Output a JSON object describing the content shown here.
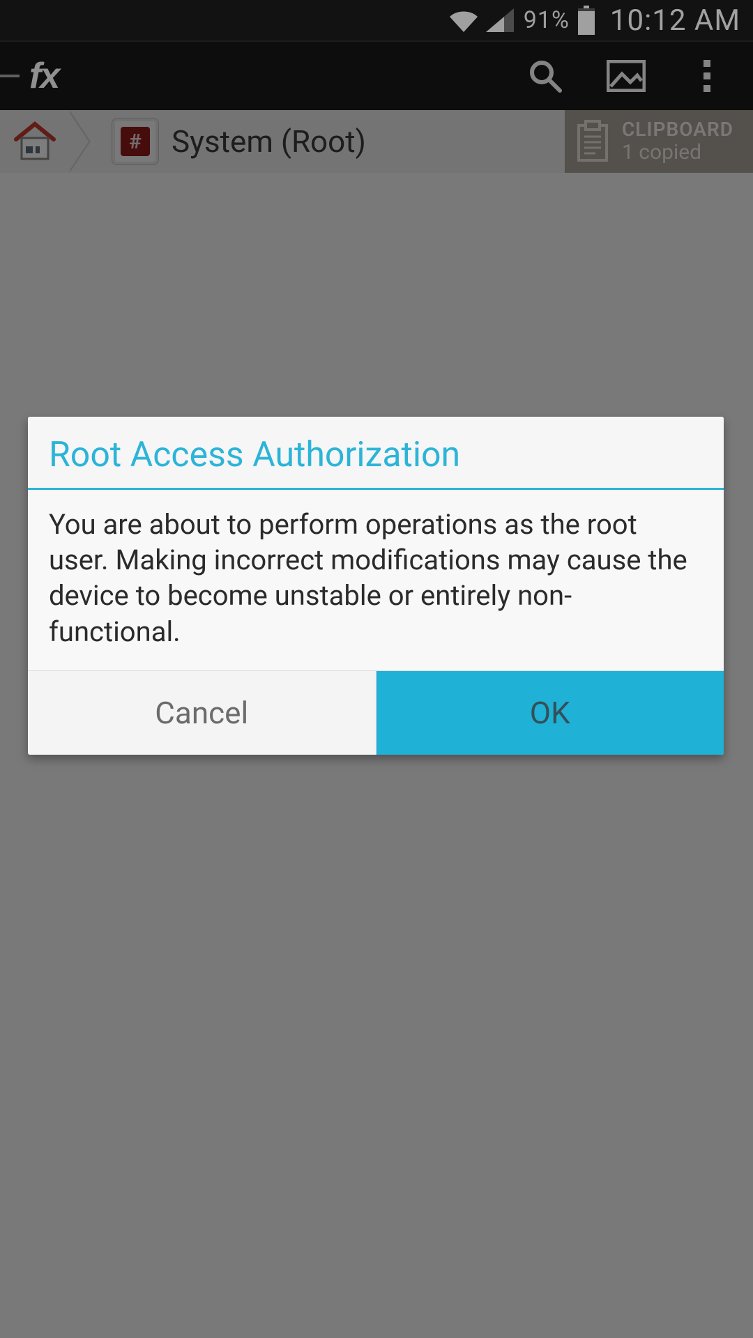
{
  "status": {
    "battery_pct": "91%",
    "time": "10:12 AM"
  },
  "appbar": {
    "logo_text": "fx",
    "icons": {
      "search": "search-icon",
      "image": "image-icon",
      "overflow": "overflow-icon"
    }
  },
  "breadcrumb": {
    "title": "System (Root)",
    "root_badge": "#"
  },
  "clipboard": {
    "title": "CLIPBOARD",
    "subtitle": "1 copied"
  },
  "dialog": {
    "title": "Root Access Authorization",
    "body": "You are about to perform operations as the root user. Making incorrect modifications may cause the device to become unstable or entirely non-functional.",
    "cancel": "Cancel",
    "ok": "OK"
  },
  "colors": {
    "accent": "#1fb1d6",
    "titleAccent": "#2cb4d8"
  }
}
